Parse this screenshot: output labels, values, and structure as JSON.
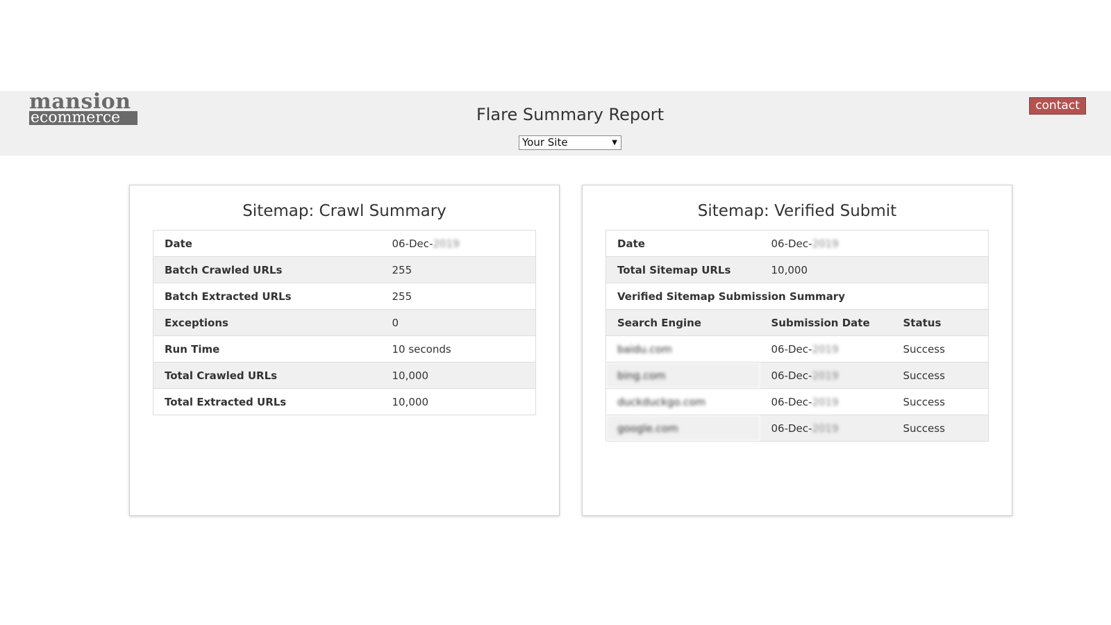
{
  "header": {
    "logo_top": "mansion",
    "logo_bottom": "ecommerce",
    "title": "Flare Summary Report",
    "site_select": "Your Site",
    "contact_label": "contact"
  },
  "crawl": {
    "title": "Sitemap: Crawl Summary",
    "rows": [
      {
        "label": "Date",
        "value": "06-Dec-",
        "blur": "2019"
      },
      {
        "label": "Batch Crawled URLs",
        "value": "255"
      },
      {
        "label": "Batch Extracted URLs",
        "value": "255"
      },
      {
        "label": "Exceptions",
        "value": "0"
      },
      {
        "label": "Run Time",
        "value": "10 seconds"
      },
      {
        "label": "Total Crawled URLs",
        "value": "10,000"
      },
      {
        "label": "Total Extracted URLs",
        "value": "10,000"
      }
    ]
  },
  "verified": {
    "title": "Sitemap: Verified Submit",
    "date_label": "Date",
    "date_value": "06-Dec-",
    "date_blur": "2019",
    "total_label": "Total Sitemap URLs",
    "total_value": "10,000",
    "summary_label": "Verified Sitemap Submission Summary",
    "headers": [
      "Search Engine",
      "Submission Date",
      "Status"
    ],
    "rows": [
      {
        "engine": "baidu.com",
        "date": "06-Dec-",
        "year": "2019",
        "status": "Success"
      },
      {
        "engine": "bing.com",
        "date": "06-Dec-",
        "year": "2019",
        "status": "Success"
      },
      {
        "engine": "duckduckgo.com",
        "date": "06-Dec-",
        "year": "2019",
        "status": "Success"
      },
      {
        "engine": "google.com",
        "date": "06-Dec-",
        "year": "2019",
        "status": "Success"
      }
    ]
  },
  "colors": {
    "header_bg": "#f0f0f0",
    "contact_bg": "#b35350",
    "exception_red": "#b34a3f",
    "row_alt": "#f0f0f0"
  }
}
